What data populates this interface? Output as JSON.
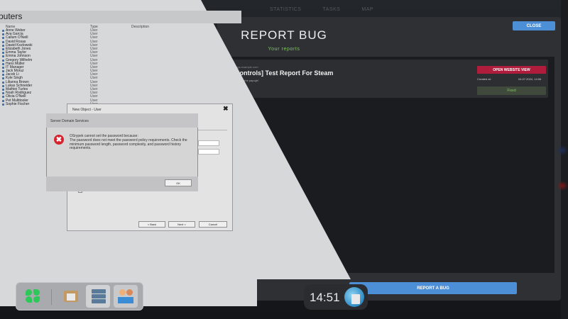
{
  "top_menu": [
    "STATISTICS",
    "TASKS",
    "MAP"
  ],
  "report_bug": {
    "title": "REPORT BUG",
    "subtitle": "Your reports",
    "close_label": "CLOSE",
    "report_button_label": "REPORT A BUG",
    "report": {
      "url": "bugs.example.com",
      "title": "[Controls] Test Report For Steam",
      "subtitle": "...ola? tehe papujel",
      "open_website_label": "OPEN WEBSITE VIEW",
      "created_label": "Created at:",
      "created_value": "04.07.2024, 14:06",
      "status": "Fixed"
    }
  },
  "clock": {
    "time": "14:51"
  },
  "server_window": {
    "title": "puters",
    "columns": {
      "name": "Name",
      "type": "Type",
      "description": "Description"
    },
    "users": [
      {
        "name": "Anne Weber",
        "type": "User"
      },
      {
        "name": "Ava Garcia",
        "type": "User"
      },
      {
        "name": "Callum O'Neill",
        "type": "User"
      },
      {
        "name": "David Rosas",
        "type": "User"
      },
      {
        "name": "Dawid Kozlowski",
        "type": "User"
      },
      {
        "name": "Elizabeth Jones",
        "type": "User"
      },
      {
        "name": "Emma Taylor",
        "type": "User"
      },
      {
        "name": "Emma Johnson",
        "type": "User"
      },
      {
        "name": "Gregory Wilhelm",
        "type": "User"
      },
      {
        "name": "Hans Müller",
        "type": "User"
      },
      {
        "name": "IT Manager",
        "type": "User"
      },
      {
        "name": "Jack Moruz",
        "type": "User"
      },
      {
        "name": "Jacob Li",
        "type": "User"
      },
      {
        "name": "Kyle Singh",
        "type": "User"
      },
      {
        "name": "Lilianna Brown",
        "type": "User"
      },
      {
        "name": "Lukas Schneider",
        "type": "User"
      },
      {
        "name": "Mathiei Turles",
        "type": "User"
      },
      {
        "name": "Noah Rodriguez",
        "type": "User"
      },
      {
        "name": "Olivia O'Neill",
        "type": "User"
      },
      {
        "name": "Pet Multitooler",
        "type": "User"
      },
      {
        "name": "Sophie Fischer",
        "type": "User"
      }
    ]
  },
  "new_object_dialog": {
    "title": "New Object - User",
    "close_glyph": "✖",
    "account_disabled_label": "Account is disabled",
    "back_label": "< Back",
    "next_label": "Next >",
    "cancel_label": "Cancel"
  },
  "error_dialog": {
    "title": "Server Domain Services",
    "icon_glyph": "✖",
    "message_line1": "OSrypek cannot set the password because:",
    "message_line2": "The password does not meet the password policy requirements. Check the minimum password length, password complexity, and password history requirements.",
    "ok_label": "OK"
  },
  "colors": {
    "accent_blue": "#4d8fd6",
    "open_website_red": "#b01c3c",
    "fixed_green": "#7ec85a",
    "error_red": "#d6232e"
  }
}
